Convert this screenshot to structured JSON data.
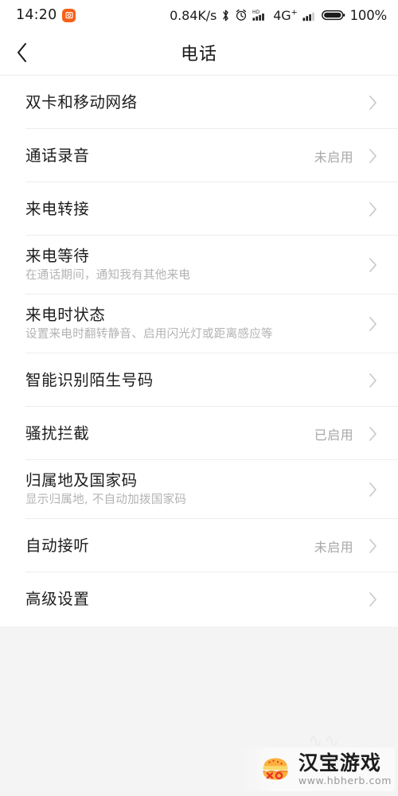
{
  "status_bar": {
    "time": "14:20",
    "badge_icon": "screenshot-app-icon",
    "badge_color": "#f4611a",
    "network_speed": "0.84K/s",
    "bluetooth_icon": "bluetooth-icon",
    "alarm_icon": "alarm-clock-icon",
    "hd_signal_icon": "hd-signal-bars-icon",
    "network_type": "4G",
    "network_type_suffix": "+",
    "signal_icon": "signal-bars-icon",
    "battery_icon": "battery-full-icon",
    "battery_percent": "100%"
  },
  "header": {
    "back_icon": "back-chevron-icon",
    "title": "电话"
  },
  "settings": {
    "rows": [
      {
        "title": "双卡和移动网络",
        "subtitle": "",
        "value": ""
      },
      {
        "title": "通话录音",
        "subtitle": "",
        "value": "未启用"
      },
      {
        "title": "来电转接",
        "subtitle": "",
        "value": ""
      },
      {
        "title": "来电等待",
        "subtitle": "在通话期间，通知我有其他来电",
        "value": ""
      },
      {
        "title": "来电时状态",
        "subtitle": "设置来电时翻转静音、启用闪光灯或距离感应等",
        "value": ""
      },
      {
        "title": "智能识别陌生号码",
        "subtitle": "",
        "value": ""
      },
      {
        "title": "骚扰拦截",
        "subtitle": "",
        "value": "已启用"
      },
      {
        "title": "归属地及国家码",
        "subtitle": "显示归属地, 不自动加拨国家码",
        "value": ""
      },
      {
        "title": "自动接听",
        "subtitle": "",
        "value": "未启用"
      },
      {
        "title": "高级设置",
        "subtitle": "",
        "value": ""
      }
    ]
  },
  "watermark": {
    "logo_icon": "burger-logo-icon",
    "title": "汉宝游戏",
    "url": "www.hbherb.com",
    "logo_color": "#fcb03c",
    "logo_accent": "#e8332a"
  }
}
